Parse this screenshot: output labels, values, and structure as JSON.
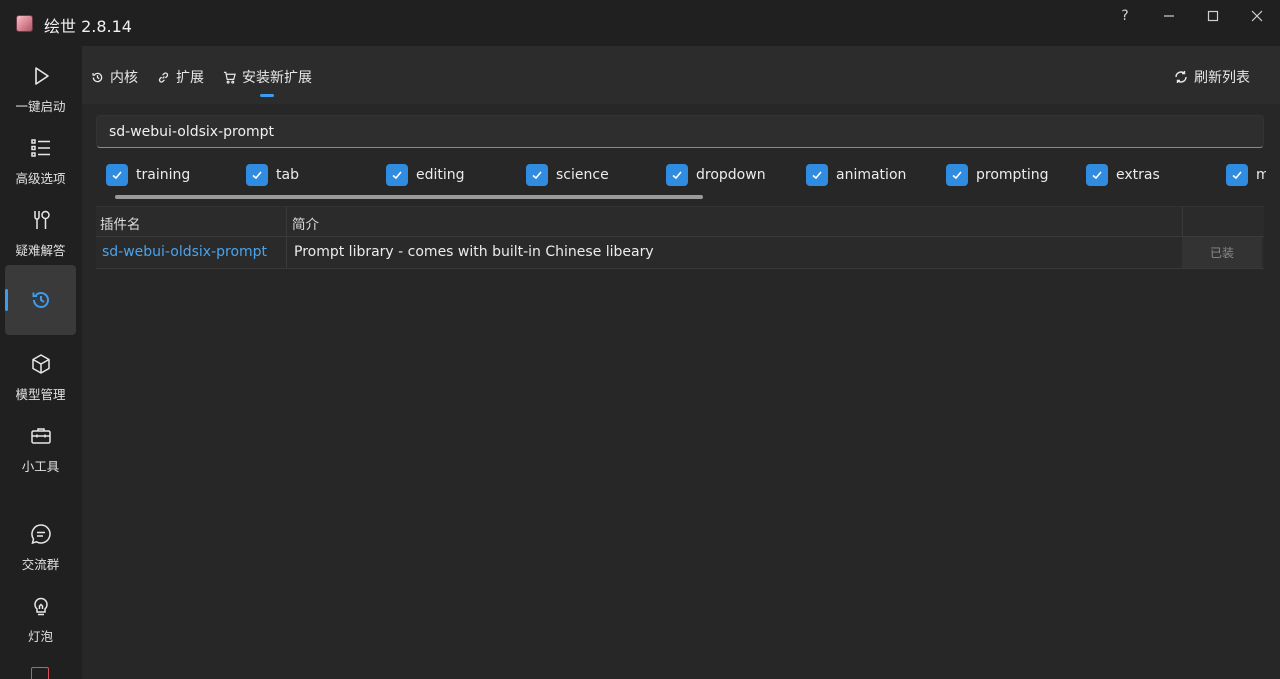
{
  "window": {
    "title": "绘世 2.8.14",
    "help_label": "?"
  },
  "sidebar": {
    "items": [
      {
        "label": "一键启动",
        "icon": "play-icon"
      },
      {
        "label": "高级选项",
        "icon": "list-icon"
      },
      {
        "label": "疑难解答",
        "icon": "tools-icon"
      },
      {
        "label": "",
        "icon": "history-icon",
        "active": true
      },
      {
        "label": "模型管理",
        "icon": "cube-icon"
      },
      {
        "label": "小工具",
        "icon": "toolbox-icon"
      },
      {
        "label": "交流群",
        "icon": "chat-icon"
      },
      {
        "label": "灯泡",
        "icon": "bulb-icon"
      }
    ]
  },
  "tabs": [
    {
      "label": "内核",
      "icon": "history-icon"
    },
    {
      "label": "扩展",
      "icon": "link-icon"
    },
    {
      "label": "安装新扩展",
      "icon": "cart-icon",
      "active": true
    }
  ],
  "refresh_label": "刷新列表",
  "search": {
    "value": "sd-webui-oldsix-prompt"
  },
  "filters": [
    "training",
    "tab",
    "editing",
    "science",
    "dropdown",
    "animation",
    "prompting",
    "extras",
    "models"
  ],
  "table": {
    "headers": [
      "插件名",
      "简介"
    ],
    "rows": [
      {
        "name": "sd-webui-oldsix-prompt",
        "description": "Prompt library - comes with built-in Chinese libeary",
        "status": "已装"
      }
    ]
  },
  "colors": {
    "accent": "#3b9cf0",
    "link": "#4aa3ec",
    "background": "#272727"
  }
}
